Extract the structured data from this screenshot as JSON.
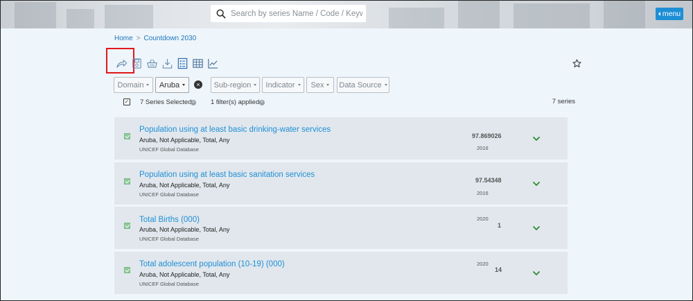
{
  "header": {
    "search_placeholder": "Search by series Name / Code / Keyword",
    "menu_label": "menu"
  },
  "breadcrumb": {
    "home": "Home",
    "separator": ">",
    "current": "Countdown 2030"
  },
  "toolbar": {
    "icons": [
      "share-icon",
      "save-icon",
      "basket-icon",
      "download-icon",
      "list-view-icon",
      "table-view-icon",
      "chart-view-icon"
    ],
    "favorite_icon": "star-icon"
  },
  "filters": {
    "domain": "Domain",
    "country": "Aruba",
    "subregion": "Sub-region",
    "indicator": "Indicator",
    "sex": "Sex",
    "data_source": "Data Source"
  },
  "status": {
    "selected": "7 Series Selected",
    "filters_applied": "1 filter(s) applied",
    "series_count": "7 series"
  },
  "series": [
    {
      "title": "Population using at least basic drinking-water services",
      "dims": "Aruba, Not Applicable, Total, Any",
      "source": "UNICEF Global Database",
      "value": "97.869026",
      "year": "2016"
    },
    {
      "title": "Population using at least basic sanitation services",
      "dims": "Aruba, Not Applicable, Total, Any",
      "source": "UNICEF Global Database",
      "value": "97.54348",
      "year": "2016"
    },
    {
      "title": "Total Births (000)",
      "dims": "Aruba, Not Applicable, Total, Any",
      "source": "UNICEF Global Database",
      "value": "1",
      "year": "2020"
    },
    {
      "title": "Total adolescent population (10-19) (000)",
      "dims": "Aruba, Not Applicable, Total, Any",
      "source": "UNICEF Global Database",
      "value": "14",
      "year": "2020"
    }
  ],
  "colors": {
    "link": "#1e8fd6",
    "highlight": "#e0171d",
    "chevron": "#2e8b2e",
    "checkbox": "#8fc99a"
  }
}
